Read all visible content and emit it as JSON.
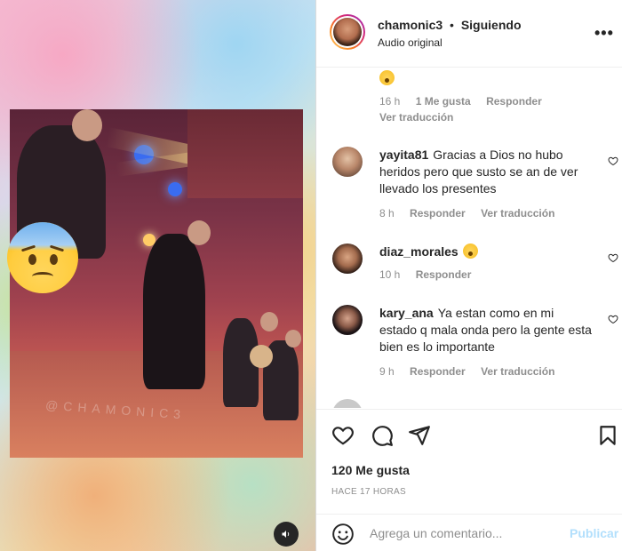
{
  "post": {
    "username": "chamonic3",
    "separator": "•",
    "follow_status": "Siguiendo",
    "audio": "Audio original",
    "more_label": "•••"
  },
  "media": {
    "watermark": "@CHAMONIC3",
    "overlay_emoji": "anxious-face-with-sweat",
    "sound_icon": "speaker-icon"
  },
  "comments": [
    {
      "username": "",
      "text": "",
      "emoji": "hushed-face",
      "time": "16 h",
      "likes": "1 Me gusta",
      "reply": "Responder",
      "translate": "Ver traducción"
    },
    {
      "username": "yayita81",
      "text": "Gracias a Dios no hubo heridos pero que susto se an de ver llevado los presentes",
      "time": "8 h",
      "reply": "Responder",
      "translate": "Ver traducción"
    },
    {
      "username": "diaz_morales",
      "text": "",
      "emoji": "hushed-face",
      "time": "10 h",
      "reply": "Responder"
    },
    {
      "username": "kary_ana",
      "text": "Ya estan como en mi estado q mala onda pero la gente esta bien es lo importante",
      "time": "9 h",
      "reply": "Responder",
      "translate": "Ver traducción"
    }
  ],
  "stats": {
    "likes": "120 Me gusta",
    "time_ago": "HACE 17 HORAS"
  },
  "add_comment": {
    "placeholder": "Agrega un comentario...",
    "post_label": "Publicar"
  },
  "colors": {
    "text": "#262626",
    "secondary": "#8e8e8e",
    "link_disabled": "#b2dffc",
    "border": "#dbdbdb"
  }
}
